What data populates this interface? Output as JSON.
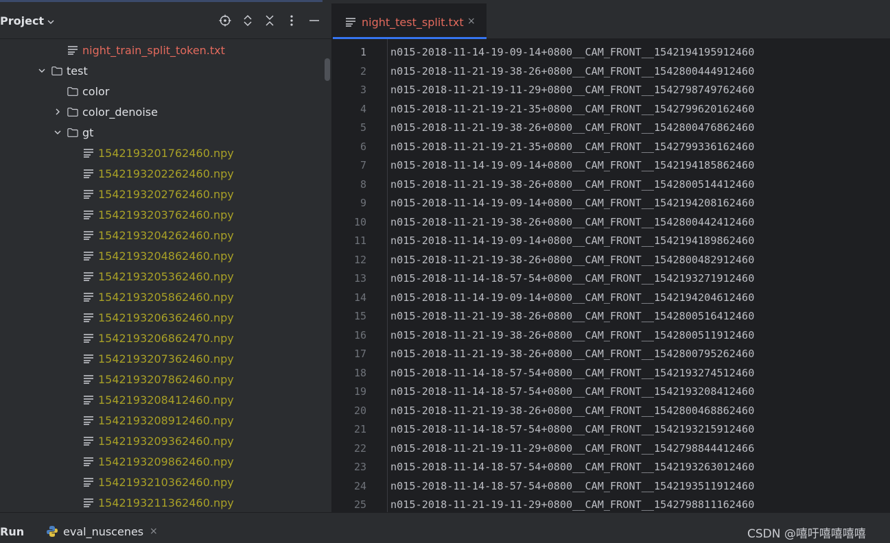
{
  "project_panel": {
    "title": "Project",
    "tools": [
      "locate-icon",
      "expand-all-icon",
      "collapse-all-icon",
      "more-icon",
      "minimize-icon"
    ],
    "tree": [
      {
        "label": "night_train_split_token.txt",
        "type": "file",
        "color": "red",
        "depth": 5
      },
      {
        "label": "test",
        "type": "folder",
        "expanded": true,
        "depth": 4
      },
      {
        "label": "color",
        "type": "folder",
        "depth": 5
      },
      {
        "label": "color_denoise",
        "type": "folder",
        "expanded": false,
        "depth": 5
      },
      {
        "label": "gt",
        "type": "folder",
        "expanded": true,
        "depth": 5
      },
      {
        "label": "1542193201762460.npy",
        "type": "file",
        "color": "yellow",
        "depth": 6
      },
      {
        "label": "1542193202262460.npy",
        "type": "file",
        "color": "yellow",
        "depth": 6
      },
      {
        "label": "1542193202762460.npy",
        "type": "file",
        "color": "yellow",
        "depth": 6
      },
      {
        "label": "1542193203762460.npy",
        "type": "file",
        "color": "yellow",
        "depth": 6
      },
      {
        "label": "1542193204262460.npy",
        "type": "file",
        "color": "yellow",
        "depth": 6
      },
      {
        "label": "1542193204862460.npy",
        "type": "file",
        "color": "yellow",
        "depth": 6
      },
      {
        "label": "1542193205362460.npy",
        "type": "file",
        "color": "yellow",
        "depth": 6
      },
      {
        "label": "1542193205862460.npy",
        "type": "file",
        "color": "yellow",
        "depth": 6
      },
      {
        "label": "1542193206362460.npy",
        "type": "file",
        "color": "yellow",
        "depth": 6
      },
      {
        "label": "1542193206862470.npy",
        "type": "file",
        "color": "yellow",
        "depth": 6
      },
      {
        "label": "1542193207362460.npy",
        "type": "file",
        "color": "yellow",
        "depth": 6
      },
      {
        "label": "1542193207862460.npy",
        "type": "file",
        "color": "yellow",
        "depth": 6
      },
      {
        "label": "1542193208412460.npy",
        "type": "file",
        "color": "yellow",
        "depth": 6
      },
      {
        "label": "1542193208912460.npy",
        "type": "file",
        "color": "yellow",
        "depth": 6
      },
      {
        "label": "1542193209362460.npy",
        "type": "file",
        "color": "yellow",
        "depth": 6
      },
      {
        "label": "1542193209862460.npy",
        "type": "file",
        "color": "yellow",
        "depth": 6
      },
      {
        "label": "1542193210362460.npy",
        "type": "file",
        "color": "yellow",
        "depth": 6
      },
      {
        "label": "1542193211362460.npy",
        "type": "file",
        "color": "yellow",
        "depth": 6
      }
    ]
  },
  "editor": {
    "tab": {
      "label": "night_test_split.txt",
      "close": "×"
    },
    "lines": [
      "n015-2018-11-14-19-09-14+0800__CAM_FRONT__1542194195912460",
      "n015-2018-11-21-19-38-26+0800__CAM_FRONT__1542800444912460",
      "n015-2018-11-21-19-11-29+0800__CAM_FRONT__1542798749762460",
      "n015-2018-11-21-19-21-35+0800__CAM_FRONT__1542799620162460",
      "n015-2018-11-21-19-38-26+0800__CAM_FRONT__1542800476862460",
      "n015-2018-11-21-19-21-35+0800__CAM_FRONT__1542799336162460",
      "n015-2018-11-14-19-09-14+0800__CAM_FRONT__1542194185862460",
      "n015-2018-11-21-19-38-26+0800__CAM_FRONT__1542800514412460",
      "n015-2018-11-14-19-09-14+0800__CAM_FRONT__1542194208162460",
      "n015-2018-11-21-19-38-26+0800__CAM_FRONT__1542800442412460",
      "n015-2018-11-14-19-09-14+0800__CAM_FRONT__1542194189862460",
      "n015-2018-11-21-19-38-26+0800__CAM_FRONT__1542800482912460",
      "n015-2018-11-14-18-57-54+0800__CAM_FRONT__1542193271912460",
      "n015-2018-11-14-19-09-14+0800__CAM_FRONT__1542194204612460",
      "n015-2018-11-21-19-38-26+0800__CAM_FRONT__1542800516412460",
      "n015-2018-11-21-19-38-26+0800__CAM_FRONT__1542800511912460",
      "n015-2018-11-21-19-38-26+0800__CAM_FRONT__1542800795262460",
      "n015-2018-11-14-18-57-54+0800__CAM_FRONT__1542193274512460",
      "n015-2018-11-14-18-57-54+0800__CAM_FRONT__1542193208412460",
      "n015-2018-11-21-19-38-26+0800__CAM_FRONT__1542800468862460",
      "n015-2018-11-14-18-57-54+0800__CAM_FRONT__1542193215912460",
      "n015-2018-11-21-19-11-29+0800__CAM_FRONT__1542798844412466",
      "n015-2018-11-14-18-57-54+0800__CAM_FRONT__1542193263012460",
      "n015-2018-11-14-18-57-54+0800__CAM_FRONT__1542193511912460",
      "n015-2018-11-21-19-11-29+0800__CAM_FRONT__1542798811162460"
    ]
  },
  "bottom_bar": {
    "run_label": "Run",
    "run_tab_label": "eval_nuscenes",
    "run_tab_close": "×",
    "watermark": "CSDN @嘻吁嘻嘻嘻嘻"
  },
  "colors": {
    "panel_bg": "#2b2d30",
    "editor_bg": "#1e1f22",
    "modified_file": "#e36a5d",
    "untracked_file": "#a8a027",
    "accent": "#3574f0"
  }
}
